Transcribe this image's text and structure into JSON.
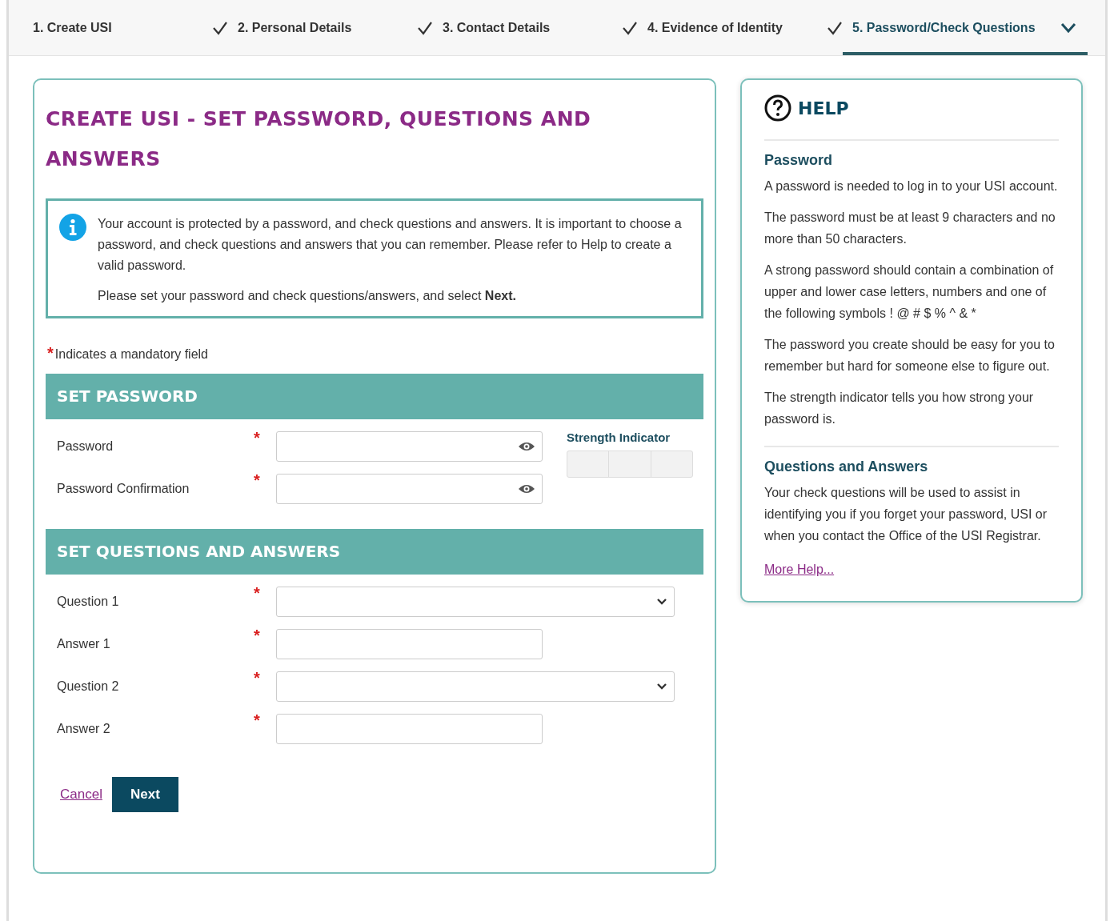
{
  "steps": [
    {
      "label": "1. Create USI",
      "completed": true,
      "selected": false
    },
    {
      "label": "2. Personal Details",
      "completed": true,
      "selected": false
    },
    {
      "label": "3. Contact Details",
      "completed": true,
      "selected": false
    },
    {
      "label": "4. Evidence of Identity",
      "completed": true,
      "selected": false
    },
    {
      "label": "5. Password/Check Questions",
      "completed": false,
      "selected": true
    }
  ],
  "form": {
    "title": "CREATE USI - SET PASSWORD, QUESTIONS AND ANSWERS",
    "info": [
      "Your account is protected by a password, and check questions and answers. It is important to choose a password, and check questions and answers that you can remember. Please refer to Help to create a valid password.",
      "Please set your password and check questions/answers, and select **Next.**"
    ],
    "mandatory_mark": "*",
    "mandatory_note": "Indicates a mandatory field",
    "sections": [
      {
        "heading": "SET PASSWORD",
        "strength_label": "Strength Indicator",
        "fields": [
          {
            "label": "Password",
            "kind": "password",
            "required": true
          },
          {
            "label": "Password Confirmation",
            "kind": "password",
            "required": true
          }
        ]
      },
      {
        "heading": "SET QUESTIONS AND ANSWERS",
        "fields": [
          {
            "label": "Question 1",
            "kind": "select",
            "required": true
          },
          {
            "label": "Answer 1",
            "kind": "text",
            "required": true
          },
          {
            "label": "Question 2",
            "kind": "select",
            "required": true
          },
          {
            "label": "Answer 2",
            "kind": "text",
            "required": true
          }
        ]
      }
    ],
    "cancel": "Cancel",
    "next": "Next"
  },
  "help": {
    "title": "HELP",
    "sections": [
      {
        "heading": "Password",
        "paragraphs": [
          "A password is needed to log in to your USI account.",
          "The password must be at least 9 characters and no more than 50 characters.",
          "A strong password should contain a combination of upper and lower case letters, numbers and one of the following symbols ! @ # $ % ^ & *",
          "The password you create should be easy for you to remember but hard for someone else to figure out.",
          "The strength indicator tells you how strong your password is."
        ]
      },
      {
        "heading": "Questions and Answers",
        "paragraphs": [
          "Your check questions will be used to assist in identifying you if you forget your password, USI or when you contact the Office of the USI Registrar."
        ]
      }
    ],
    "link": "More Help..."
  }
}
